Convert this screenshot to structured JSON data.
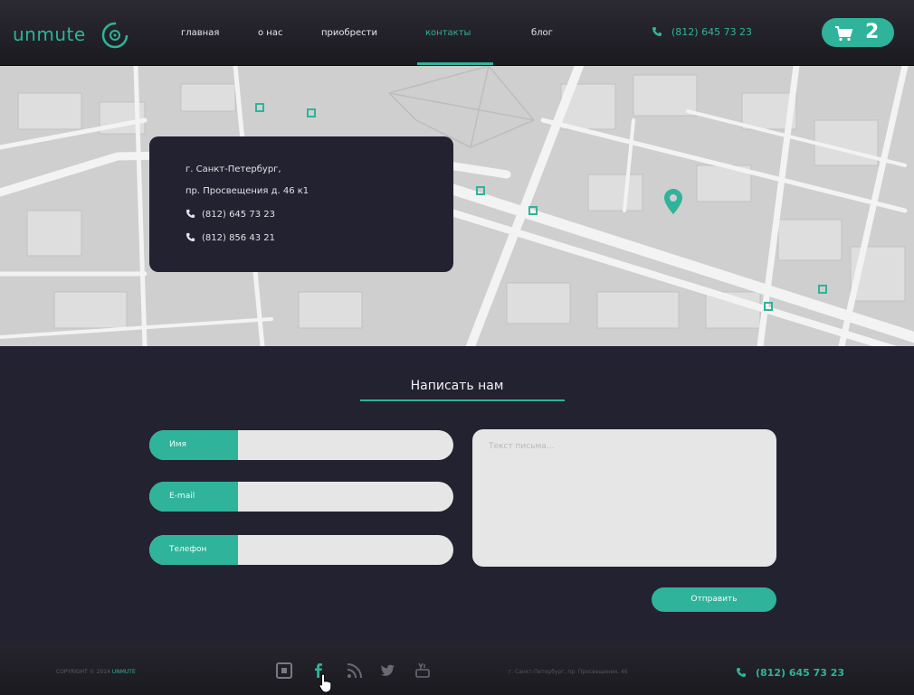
{
  "brand": {
    "logo_text": "unmute"
  },
  "nav": {
    "items": [
      {
        "label": "главная"
      },
      {
        "label": "о нас"
      },
      {
        "label": "приобрести"
      },
      {
        "label": "контакты",
        "active": true
      },
      {
        "label": "блог"
      }
    ]
  },
  "header": {
    "phone": "(812) 645 73 23",
    "cart_count": "2"
  },
  "map": {
    "address_line1": "г. Санкт-Петербург,",
    "address_line2": "пр. Просвещения  д. 46 к1",
    "phone1": "(812) 645 73 23",
    "phone2": "(812) 856 43 21"
  },
  "form": {
    "title": "Написать нам",
    "name_label": "Имя",
    "email_label": "E-mail",
    "phone_label": "Телефон",
    "message_placeholder": "Текст письма...",
    "submit_label": "Отправить"
  },
  "footer": {
    "copyright_prefix": "COPYRIGHT © 2014",
    "copyright_brand": "UNMUTE",
    "address": "г. Санкт-Петербург, пр. Просвещения, 46",
    "phone": "(812) 645 73 23"
  },
  "colors": {
    "accent": "#2fb39a",
    "dark": "#232230",
    "field": "#e6e6e6",
    "map": "#cfcfcf"
  }
}
